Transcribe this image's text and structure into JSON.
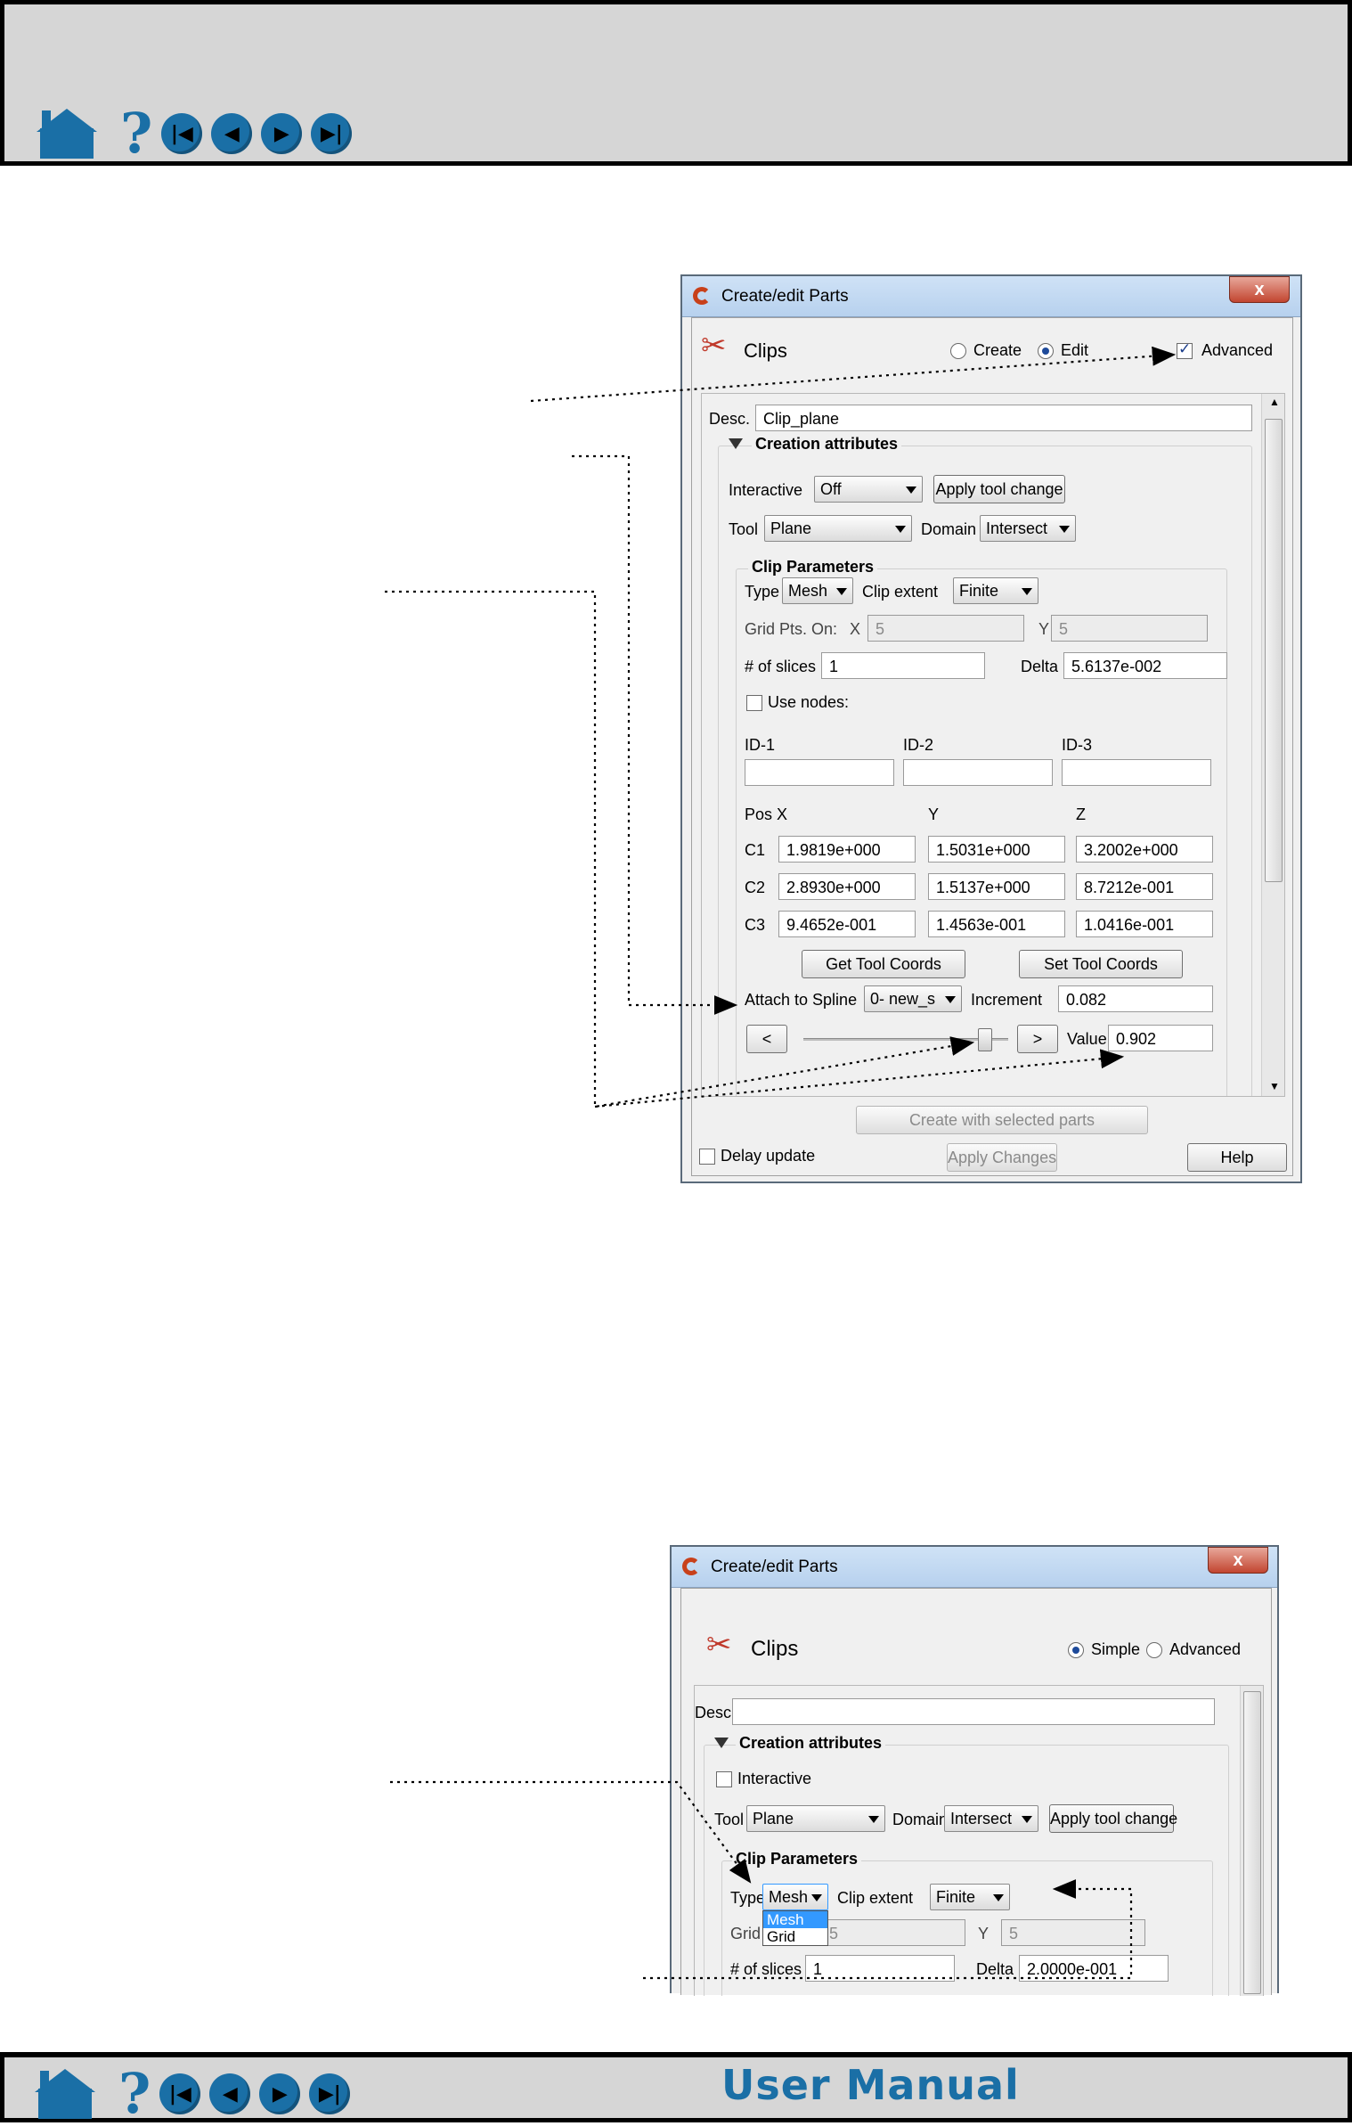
{
  "footer": {
    "title": "User Manual"
  },
  "nav": {
    "icons": [
      "home-icon",
      "help-icon",
      "first-page-icon",
      "previous-page-icon",
      "next-page-icon",
      "last-page-icon"
    ]
  },
  "dialog1": {
    "title": "Create/edit Parts",
    "close": "x",
    "section": "Clips",
    "mode_create": "Create",
    "mode_edit": "Edit",
    "advanced": "Advanced",
    "desc_label": "Desc.",
    "desc_value": "Clip_plane",
    "creation_attributes": "Creation attributes",
    "interactive_label": "Interactive",
    "interactive_value": "Off",
    "apply_tool_change": "Apply tool change",
    "tool_label": "Tool",
    "tool_value": "Plane",
    "domain_label": "Domain",
    "domain_value": "Intersect",
    "clip_parameters": "Clip Parameters",
    "type_label": "Type",
    "type_value": "Mesh",
    "clip_extent_label": "Clip extent",
    "clip_extent_value": "Finite",
    "grid_pts_label": "Grid Pts. On:",
    "grid_x_label": "X",
    "grid_x_value": "5",
    "grid_y_label": "Y",
    "grid_y_value": "5",
    "slices_label": "# of slices",
    "slices_value": "1",
    "delta_label": "Delta",
    "delta_value": "5.6137e-002",
    "use_nodes": "Use nodes:",
    "id1": "ID-1",
    "id2": "ID-2",
    "id3": "ID-3",
    "pos_label": "Pos",
    "col_x": "X",
    "col_y": "Y",
    "col_z": "Z",
    "rows": [
      {
        "label": "C1",
        "x": "1.9819e+000",
        "y": "1.5031e+000",
        "z": "3.2002e+000"
      },
      {
        "label": "C2",
        "x": "2.8930e+000",
        "y": "1.5137e+000",
        "z": "8.7212e-001"
      },
      {
        "label": "C3",
        "x": "9.4652e-001",
        "y": "1.4563e-001",
        "z": "1.0416e-001"
      }
    ],
    "get_tool_coords": "Get Tool Coords",
    "set_tool_coords": "Set Tool Coords",
    "attach_spline_label": "Attach to Spline",
    "attach_spline_value": "0- new_s",
    "increment_label": "Increment",
    "increment_value": "0.082",
    "prev": "<",
    "next": ">",
    "value_label": "Value",
    "value_value": "0.902",
    "create_with_selected": "Create with selected parts",
    "delay_update": "Delay update",
    "apply_changes": "Apply Changes",
    "help": "Help"
  },
  "dialog2": {
    "title": "Create/edit Parts",
    "close": "x",
    "section": "Clips",
    "mode_simple": "Simple",
    "mode_advanced": "Advanced",
    "desc_label": "Desc.",
    "desc_value": "",
    "creation_attributes": "Creation attributes",
    "interactive": "Interactive",
    "tool_label": "Tool",
    "tool_value": "Plane",
    "domain_label": "Domain",
    "domain_value": "Intersect",
    "apply_tool_change": "Apply tool change",
    "clip_parameters": "Clip Parameters",
    "type_label": "Type",
    "type_value": "Mesh",
    "type_options": [
      "Mesh",
      "Grid"
    ],
    "clip_extent_label": "Clip extent",
    "clip_extent_value": "Finite",
    "grid_label": "Grid P",
    "grid_x_value": "5",
    "grid_y_label": "Y",
    "grid_y_value": "5",
    "slices_label": "# of slices",
    "slices_value": "1",
    "delta_label": "Delta",
    "delta_value": "2.0000e-001"
  }
}
